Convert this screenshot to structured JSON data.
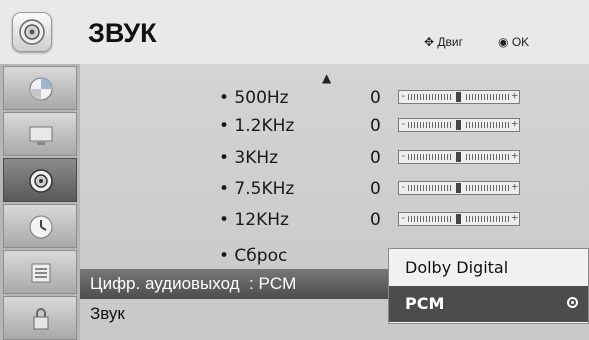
{
  "header": {
    "title": "ЗВУК",
    "hint_move": "Двиг",
    "hint_ok": "OK"
  },
  "sidebar": {
    "items": [
      {
        "icon": "picture-icon",
        "active": false
      },
      {
        "icon": "screen-icon",
        "active": false
      },
      {
        "icon": "speaker-icon",
        "active": true
      },
      {
        "icon": "time-icon",
        "active": false
      },
      {
        "icon": "option-icon",
        "active": false
      },
      {
        "icon": "lock-icon",
        "active": false
      }
    ]
  },
  "equalizer": {
    "bands": [
      {
        "label": "• 500Hz",
        "value": "0"
      },
      {
        "label": "• 1.2KHz",
        "value": "0"
      },
      {
        "label": "• 3KHz",
        "value": "0"
      },
      {
        "label": "• 7.5KHz",
        "value": "0"
      },
      {
        "label": "• 12KHz",
        "value": "0"
      }
    ],
    "reset": "• Сброс",
    "slider_minus": "-",
    "slider_plus": "+"
  },
  "menu": {
    "digital_output": "Цифр. аудиовыход  : PCM",
    "sound": "Звук"
  },
  "popup": {
    "options": [
      "Dolby Digital",
      "PCM"
    ],
    "selected": "PCM"
  }
}
